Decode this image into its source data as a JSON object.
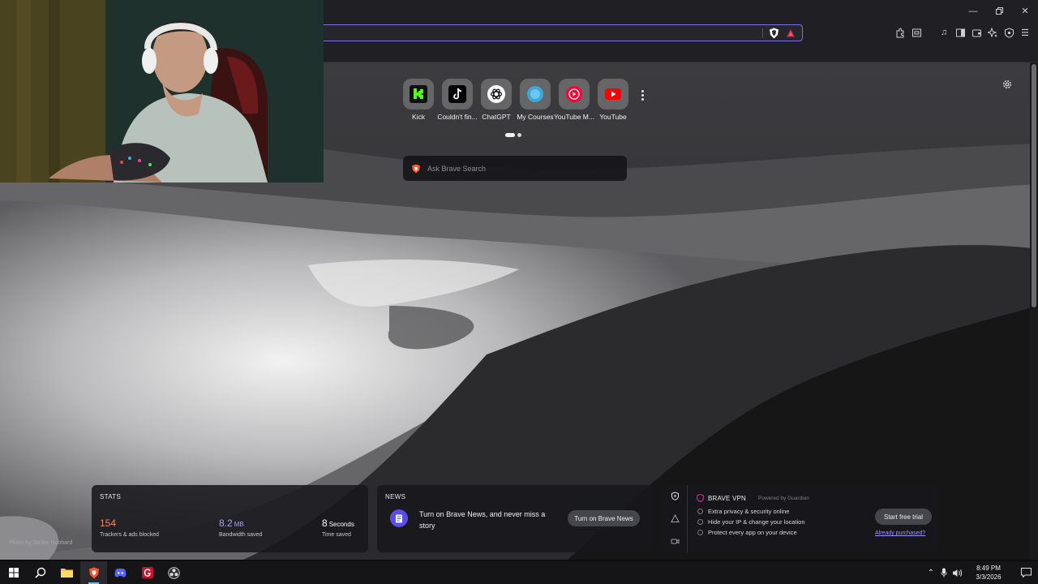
{
  "window": {
    "minimize_icon": "minimize-icon",
    "restore_icon": "restore-icon",
    "close_icon": "close-icon"
  },
  "new_tab": {
    "top_sites": [
      {
        "label": "Kick",
        "icon": "kick-icon"
      },
      {
        "label": "Couldn't fin...",
        "icon": "tiktok-icon"
      },
      {
        "label": "ChatGPT",
        "icon": "chatgpt-icon"
      },
      {
        "label": "My Courses",
        "icon": "courses-icon"
      },
      {
        "label": "YouTube M...",
        "icon": "youtube-music-icon"
      },
      {
        "label": "YouTube",
        "icon": "youtube-icon"
      }
    ],
    "search_placeholder": "Ask Brave Search",
    "photo_credit": "Photo by Jackie Hubbard"
  },
  "stats": {
    "title": "STATS",
    "trackers": {
      "value": "154",
      "label": "Trackers & ads blocked",
      "color": "#f08a5a"
    },
    "bandwidth": {
      "value": "8.2",
      "unit": "MB",
      "label": "Bandwidth saved",
      "color": "#a7a2f2"
    },
    "time": {
      "value": "8",
      "unit": "Seconds",
      "label": "Time saved"
    }
  },
  "news": {
    "title": "NEWS",
    "text": "Turn on Brave News, and never miss a story",
    "button": "Turn on Brave News"
  },
  "vpn": {
    "title": "BRAVE VPN",
    "powered": "Powered by Guardian",
    "features": [
      "Extra privacy & security online",
      "Hide your IP & change your location",
      "Protect every app on your device"
    ],
    "button": "Start free trial",
    "link": "Already purchased?"
  },
  "taskbar": {
    "apps": [
      "windows-start-icon",
      "search-icon",
      "file-explorer-icon",
      "brave-browser-icon",
      "discord-icon",
      "app-g-icon",
      "obs-icon"
    ],
    "time": "8:49 PM",
    "date": "3/3/2026"
  }
}
